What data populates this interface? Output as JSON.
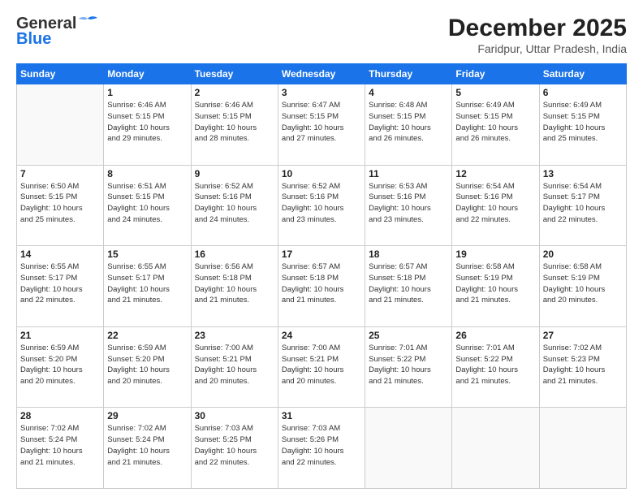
{
  "logo": {
    "line1": "General",
    "line2": "Blue"
  },
  "title": "December 2025",
  "location": "Faridpur, Uttar Pradesh, India",
  "headers": [
    "Sunday",
    "Monday",
    "Tuesday",
    "Wednesday",
    "Thursday",
    "Friday",
    "Saturday"
  ],
  "weeks": [
    [
      {
        "day": "",
        "data": ""
      },
      {
        "day": "1",
        "data": "Sunrise: 6:46 AM\nSunset: 5:15 PM\nDaylight: 10 hours\nand 29 minutes."
      },
      {
        "day": "2",
        "data": "Sunrise: 6:46 AM\nSunset: 5:15 PM\nDaylight: 10 hours\nand 28 minutes."
      },
      {
        "day": "3",
        "data": "Sunrise: 6:47 AM\nSunset: 5:15 PM\nDaylight: 10 hours\nand 27 minutes."
      },
      {
        "day": "4",
        "data": "Sunrise: 6:48 AM\nSunset: 5:15 PM\nDaylight: 10 hours\nand 26 minutes."
      },
      {
        "day": "5",
        "data": "Sunrise: 6:49 AM\nSunset: 5:15 PM\nDaylight: 10 hours\nand 26 minutes."
      },
      {
        "day": "6",
        "data": "Sunrise: 6:49 AM\nSunset: 5:15 PM\nDaylight: 10 hours\nand 25 minutes."
      }
    ],
    [
      {
        "day": "7",
        "data": "Sunrise: 6:50 AM\nSunset: 5:15 PM\nDaylight: 10 hours\nand 25 minutes."
      },
      {
        "day": "8",
        "data": "Sunrise: 6:51 AM\nSunset: 5:15 PM\nDaylight: 10 hours\nand 24 minutes."
      },
      {
        "day": "9",
        "data": "Sunrise: 6:52 AM\nSunset: 5:16 PM\nDaylight: 10 hours\nand 24 minutes."
      },
      {
        "day": "10",
        "data": "Sunrise: 6:52 AM\nSunset: 5:16 PM\nDaylight: 10 hours\nand 23 minutes."
      },
      {
        "day": "11",
        "data": "Sunrise: 6:53 AM\nSunset: 5:16 PM\nDaylight: 10 hours\nand 23 minutes."
      },
      {
        "day": "12",
        "data": "Sunrise: 6:54 AM\nSunset: 5:16 PM\nDaylight: 10 hours\nand 22 minutes."
      },
      {
        "day": "13",
        "data": "Sunrise: 6:54 AM\nSunset: 5:17 PM\nDaylight: 10 hours\nand 22 minutes."
      }
    ],
    [
      {
        "day": "14",
        "data": "Sunrise: 6:55 AM\nSunset: 5:17 PM\nDaylight: 10 hours\nand 22 minutes."
      },
      {
        "day": "15",
        "data": "Sunrise: 6:55 AM\nSunset: 5:17 PM\nDaylight: 10 hours\nand 21 minutes."
      },
      {
        "day": "16",
        "data": "Sunrise: 6:56 AM\nSunset: 5:18 PM\nDaylight: 10 hours\nand 21 minutes."
      },
      {
        "day": "17",
        "data": "Sunrise: 6:57 AM\nSunset: 5:18 PM\nDaylight: 10 hours\nand 21 minutes."
      },
      {
        "day": "18",
        "data": "Sunrise: 6:57 AM\nSunset: 5:18 PM\nDaylight: 10 hours\nand 21 minutes."
      },
      {
        "day": "19",
        "data": "Sunrise: 6:58 AM\nSunset: 5:19 PM\nDaylight: 10 hours\nand 21 minutes."
      },
      {
        "day": "20",
        "data": "Sunrise: 6:58 AM\nSunset: 5:19 PM\nDaylight: 10 hours\nand 20 minutes."
      }
    ],
    [
      {
        "day": "21",
        "data": "Sunrise: 6:59 AM\nSunset: 5:20 PM\nDaylight: 10 hours\nand 20 minutes."
      },
      {
        "day": "22",
        "data": "Sunrise: 6:59 AM\nSunset: 5:20 PM\nDaylight: 10 hours\nand 20 minutes."
      },
      {
        "day": "23",
        "data": "Sunrise: 7:00 AM\nSunset: 5:21 PM\nDaylight: 10 hours\nand 20 minutes."
      },
      {
        "day": "24",
        "data": "Sunrise: 7:00 AM\nSunset: 5:21 PM\nDaylight: 10 hours\nand 20 minutes."
      },
      {
        "day": "25",
        "data": "Sunrise: 7:01 AM\nSunset: 5:22 PM\nDaylight: 10 hours\nand 21 minutes."
      },
      {
        "day": "26",
        "data": "Sunrise: 7:01 AM\nSunset: 5:22 PM\nDaylight: 10 hours\nand 21 minutes."
      },
      {
        "day": "27",
        "data": "Sunrise: 7:02 AM\nSunset: 5:23 PM\nDaylight: 10 hours\nand 21 minutes."
      }
    ],
    [
      {
        "day": "28",
        "data": "Sunrise: 7:02 AM\nSunset: 5:24 PM\nDaylight: 10 hours\nand 21 minutes."
      },
      {
        "day": "29",
        "data": "Sunrise: 7:02 AM\nSunset: 5:24 PM\nDaylight: 10 hours\nand 21 minutes."
      },
      {
        "day": "30",
        "data": "Sunrise: 7:03 AM\nSunset: 5:25 PM\nDaylight: 10 hours\nand 22 minutes."
      },
      {
        "day": "31",
        "data": "Sunrise: 7:03 AM\nSunset: 5:26 PM\nDaylight: 10 hours\nand 22 minutes."
      },
      {
        "day": "",
        "data": ""
      },
      {
        "day": "",
        "data": ""
      },
      {
        "day": "",
        "data": ""
      }
    ]
  ]
}
